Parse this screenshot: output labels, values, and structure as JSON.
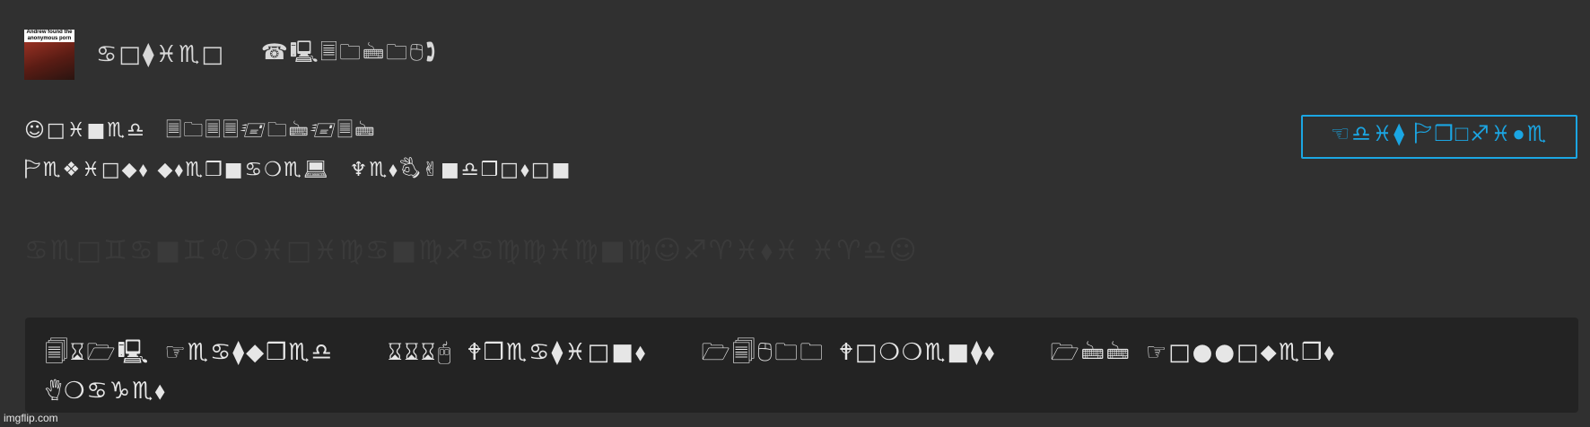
{
  "avatar": {
    "caption": "Andrew found the anonymous porn"
  },
  "header": {
    "username": "♋︎□︎⧫︎♓︎♏︎□︎",
    "user_id": "☎︎🖳︎🗏︎🗀︎🖮︎🗀︎🖰︎🕽︎"
  },
  "profile": {
    "joined_label": "☺︎□︎♓︎■︎♏︎♎︎",
    "joined_value": "🗏︎🗀︎🗏︎🗏︎🖅︎🗀︎🖮︎🖅︎🗏︎🖮︎",
    "previous_usernames_label": "🏱︎♏︎❖︎♓︎□︎◆︎⬧︎ ◆︎⬧︎♏︎❒︎■︎♋︎❍︎♏︎💻︎",
    "previous_usernames_value": "♆︎♏︎⬧︎🖏︎✌︎■︎♎︎❒︎□︎⬧︎□︎■︎"
  },
  "follow_button": {
    "label": "☜︎♎︎♓︎⧫︎ 🏱︎❒︎□︎♐︎♓︎●︎♏︎"
  },
  "faded_text": "♋︎♏︎□︎♊︎♋︎■︎♊︎♌︎❍︎♓︎□︎♓︎♍︎♋︎■︎♍︎♐︎♋︎♍︎♍︎♓︎♍︎■︎♍︎☺︎♐︎♈︎♓︎⬧︎♓︎ ♓︎♈︎♎︎☺︎",
  "stats": {
    "featured_count": "🗐︎⌛︎🗁︎🖳︎",
    "featured_label": "☞︎♏︎♋︎⧫︎◆︎❒︎♏︎♎︎",
    "creations_count": "⌛︎⌛︎⌛︎🖰︎",
    "creations_label": "🕈︎❒︎♏︎♋︎⧫︎♓︎□︎■︎⬧︎",
    "comments_count": "🗁︎🗐︎🖰︎🗀︎🗀︎",
    "comments_label": "🕈︎□︎❍︎❍︎♏︎■︎⧫︎⬧︎",
    "followers_count": "🗁︎🖮︎🖮︎",
    "followers_label": "☞︎□︎●︎●︎□︎⬥︎♏︎❒︎⬧︎",
    "images_label": "🖐︎❍︎♋︎♑︎♏︎⬧︎"
  },
  "watermark": "imgflip.com"
}
